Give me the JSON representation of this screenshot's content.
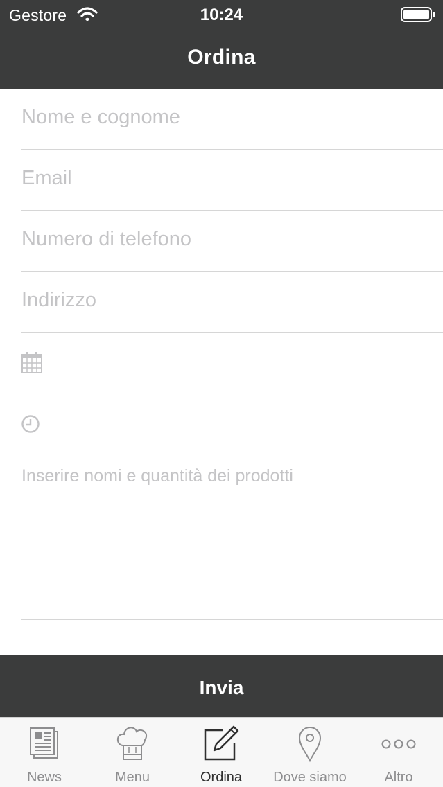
{
  "status_bar": {
    "carrier": "Gestore",
    "time": "10:24"
  },
  "nav": {
    "title": "Ordina"
  },
  "form": {
    "name_placeholder": "Nome e cognome",
    "email_placeholder": "Email",
    "phone_placeholder": "Numero di telefono",
    "address_placeholder": "Indirizzo",
    "date_icon": "calendar-icon",
    "time_icon": "clock-icon",
    "notes_placeholder": "Inserire nomi e quantità dei prodotti"
  },
  "send_button": {
    "label": "Invia"
  },
  "tabbar": {
    "active": "Ordina",
    "tabs": [
      {
        "label": "News",
        "icon": "newspaper-icon"
      },
      {
        "label": "Menu",
        "icon": "chef-hat-icon"
      },
      {
        "label": "Ordina",
        "icon": "edit-icon"
      },
      {
        "label": "Dove siamo",
        "icon": "location-pin-icon"
      },
      {
        "label": "Altro",
        "icon": "more-icon"
      }
    ]
  },
  "colors": {
    "bar": "#3b3c3c",
    "placeholder": "#c4c4c6",
    "tab_inactive": "#8d8d8f",
    "tab_active": "#2f2f2f"
  }
}
